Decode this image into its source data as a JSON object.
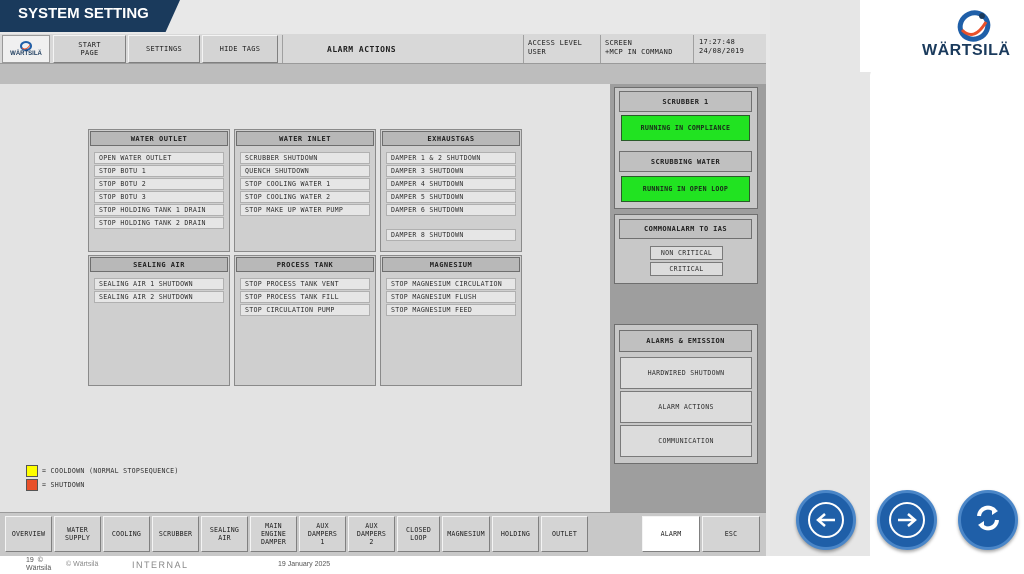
{
  "slide": {
    "title": "SYSTEM SETTING",
    "logo_text": "WÄRTSILÄ",
    "footer": {
      "page_number": "19",
      "copyright_symbol": "©",
      "company": "Wärtsilä",
      "copyright": "© Wärtsilä",
      "classification": "INTERNAL",
      "date": "19 January 2025"
    }
  },
  "hmi": {
    "logo_text": "WÄRTSILÄ",
    "top_buttons": [
      {
        "label": "START\nPAGE"
      },
      {
        "label": "SETTINGS"
      },
      {
        "label": "HIDE TAGS"
      }
    ],
    "page_title": "ALARM ACTIONS",
    "access_level": {
      "label": "ACCESS LEVEL",
      "value": "USER"
    },
    "screen": {
      "label": "SCREEN",
      "value": "+MCP IN COMMAND"
    },
    "clock": {
      "time": "17:27:48",
      "date": "24/08/2019"
    },
    "groups": {
      "water_outlet": {
        "title": "WATER OUTLET",
        "items": [
          "OPEN WATER OUTLET",
          "STOP BOTU 1",
          "STOP BOTU 2",
          "STOP BOTU 3",
          "STOP HOLDING TANK 1 DRAIN",
          "STOP HOLDING TANK 2 DRAIN"
        ]
      },
      "water_inlet": {
        "title": "WATER INLET",
        "items": [
          "SCRUBBER SHUTDOWN",
          "QUENCH SHUTDOWN",
          "STOP COOLING WATER 1",
          "STOP COOLING WATER 2",
          "STOP MAKE UP WATER PUMP"
        ]
      },
      "exhaustgas": {
        "title": "EXHAUSTGAS",
        "items": [
          "DAMPER 1 & 2 SHUTDOWN",
          "DAMPER 3 SHUTDOWN",
          "DAMPER 4 SHUTDOWN",
          "DAMPER 5 SHUTDOWN",
          "DAMPER 6 SHUTDOWN",
          "DAMPER 8 SHUTDOWN"
        ]
      },
      "sealing_air": {
        "title": "SEALING AIR",
        "items": [
          "SEALING AIR 1 SHUTDOWN",
          "SEALING AIR 2 SHUTDOWN"
        ]
      },
      "process_tank": {
        "title": "PROCESS TANK",
        "items": [
          "STOP PROCESS TANK VENT",
          "STOP PROCESS TANK FILL",
          "STOP CIRCULATION PUMP"
        ]
      },
      "magnesium": {
        "title": "MAGNESIUM",
        "items": [
          "STOP MAGNESIUM CIRCULATION",
          "STOP MAGNESIUM FLUSH",
          "STOP MAGNESIUM FEED"
        ]
      }
    },
    "legend": [
      {
        "color": "#ffff00",
        "label": "= COOLDOWN (NORMAL STOPSEQUENCE)"
      },
      {
        "color": "#e8502a",
        "label": "= SHUTDOWN"
      }
    ],
    "right_panel": {
      "scrubber": {
        "title": "SCRUBBER 1",
        "status": "RUNNING IN COMPLIANCE"
      },
      "scrubbing_water": {
        "title": "SCRUBBING WATER",
        "status": "RUNNING IN OPEN LOOP"
      },
      "common_alarm": {
        "title": "COMMONALARM TO IAS",
        "items": [
          "NON CRITICAL",
          "CRITICAL"
        ]
      },
      "alarms": {
        "title": "ALARMS & EMISSION",
        "buttons": [
          "HARDWIRED SHUTDOWN",
          "ALARM ACTIONS",
          "COMMUNICATION"
        ]
      }
    },
    "bottom_nav": [
      {
        "label": "OVERVIEW"
      },
      {
        "label": "WATER\nSUPPLY"
      },
      {
        "label": "COOLING"
      },
      {
        "label": "SCRUBBER"
      },
      {
        "label": "SEALING\nAIR"
      },
      {
        "label": "MAIN\nENGINE\nDAMPER"
      },
      {
        "label": "AUX\nDAMPERS\n1"
      },
      {
        "label": "AUX\nDAMPERS\n2"
      },
      {
        "label": "CLOSED\nLOOP"
      },
      {
        "label": "MAGNESIUM"
      },
      {
        "label": "HOLDING"
      },
      {
        "label": "OUTLET"
      }
    ],
    "alarm_button": "ALARM",
    "esc_button": "ESC"
  },
  "colors": {
    "title_bg": "#1a3a5c",
    "status_green": "#21e321",
    "nav_blue": "#1f5fa8",
    "cooldown": "#ffff00",
    "shutdown": "#e8502a"
  },
  "nav_icons": [
    "back-arrow-icon",
    "forward-arrow-icon",
    "refresh-icon"
  ]
}
